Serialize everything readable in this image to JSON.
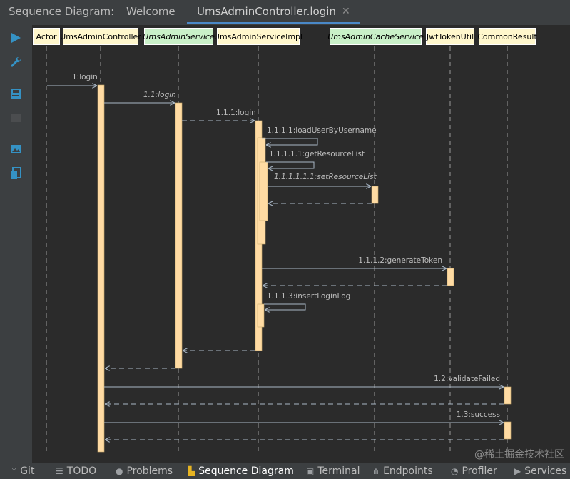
{
  "tabbar": {
    "prefix": "Sequence Diagram:",
    "tabs": [
      {
        "label": "Welcome"
      },
      {
        "label": "UmsAdminController.login",
        "active": true
      }
    ],
    "close_icon": "close-icon"
  },
  "toolbar": {
    "items": [
      {
        "icon": "play-icon"
      },
      {
        "icon": "wrench-icon"
      },
      {
        "icon": "save-icon"
      },
      {
        "icon": "folder-icon"
      },
      {
        "icon": "image-icon"
      },
      {
        "icon": "export-icon"
      }
    ]
  },
  "diagram": {
    "participants": [
      {
        "name": "Actor",
        "kind": "class"
      },
      {
        "name": "UmsAdminController",
        "kind": "class"
      },
      {
        "name": "UmsAdminService",
        "kind": "interface"
      },
      {
        "name": "UmsAdminServiceImpl",
        "kind": "class"
      },
      {
        "name": "UmsAdminCacheService",
        "kind": "interface"
      },
      {
        "name": "JwtTokenUtil",
        "kind": "class"
      },
      {
        "name": "CommonResult",
        "kind": "class"
      }
    ],
    "messages": [
      {
        "label": "1:login"
      },
      {
        "label": "1.1:login"
      },
      {
        "label": "1.1.1:login"
      },
      {
        "label": "1.1.1.1:loadUserByUsername"
      },
      {
        "label": "1.1.1.1.1:getResourceList"
      },
      {
        "label": "1.1.1.1.1.1:setResourceList"
      },
      {
        "label": "1.1.1.2:generateToken"
      },
      {
        "label": "1.1.1.3:insertLoginLog"
      },
      {
        "label": "1.2:validateFailed"
      },
      {
        "label": "1.3:success"
      }
    ]
  },
  "bottombar": {
    "items": [
      {
        "label": "Git",
        "icon": "git-branch-icon"
      },
      {
        "label": "TODO",
        "icon": "list-icon"
      },
      {
        "label": "Problems",
        "icon": "info-icon"
      },
      {
        "label": "Sequence Diagram",
        "icon": "sequence-diagram-icon",
        "active": true
      },
      {
        "label": "Terminal",
        "icon": "terminal-icon"
      },
      {
        "label": "Endpoints",
        "icon": "endpoints-icon"
      },
      {
        "label": "Profiler",
        "icon": "profiler-icon"
      },
      {
        "label": "Services",
        "icon": "services-icon"
      }
    ]
  },
  "watermark": "@稀土掘金技术社区",
  "colors": {
    "canvas_bg": "#2b2b2b",
    "chrome_bg": "#3c3f41",
    "activation": "#ffdba3",
    "class_head": "#fff7cc",
    "interface_head": "#c9f0c8",
    "accent": "#4a88c7"
  }
}
